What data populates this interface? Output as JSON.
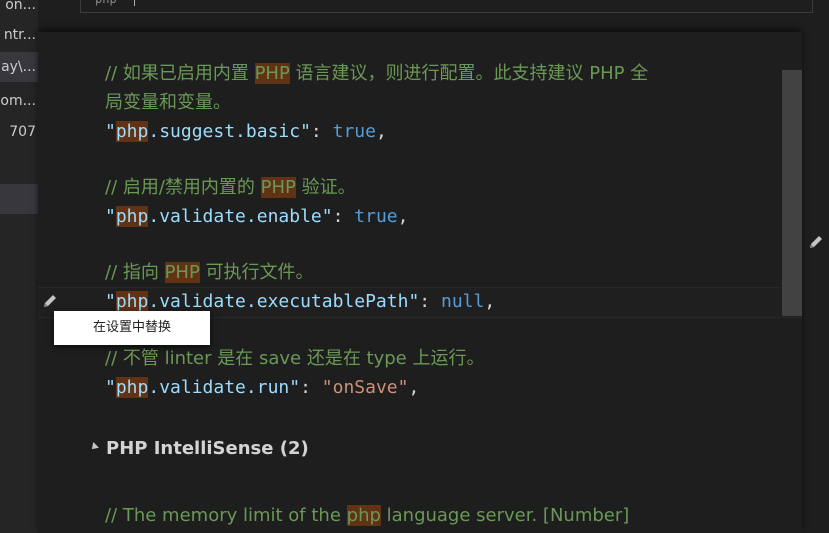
{
  "sidebar": {
    "items": [
      "on...",
      "ntr...",
      "ay\\...",
      "com...",
      "707"
    ]
  },
  "search": {
    "value": "php"
  },
  "settings": [
    {
      "comment_pre": "// 如果已启用内置 ",
      "comment_hl": "PHP",
      "comment_post": " 语言建议，则进行配置。此支持建议 PHP 全",
      "comment_line2": "局变量和变量。",
      "key_hl": "php",
      "key_rest": ".suggest.basic",
      "value": "true"
    },
    {
      "comment_pre": "// 启用/禁用内置的 ",
      "comment_hl": "PHP",
      "comment_post": " 验证。",
      "key_hl": "php",
      "key_rest": ".validate.enable",
      "value": "true"
    },
    {
      "comment_pre": "// 指向 ",
      "comment_hl": "PHP",
      "comment_post": " 可执行文件。",
      "key_hl": "php",
      "key_rest": ".validate.executablePath",
      "value": "null"
    },
    {
      "comment": "// 不管 linter 是在 save 还是在 type 上运行。",
      "key_hl": "php",
      "key_rest": ".validate.run",
      "value": "\"onSave\""
    }
  ],
  "context_menu": {
    "item": "在设置中替换"
  },
  "section": {
    "title": "PHP IntelliSense (2)"
  },
  "last_comment": {
    "pre": "// The memory limit of the ",
    "hl": "php",
    "post": " language server. [Number]"
  },
  "colors": {
    "comment": "#6a9955",
    "key": "#9cdcfe",
    "keyword_value": "#569cd6",
    "string": "#ce9178",
    "highlight": "#613214"
  }
}
